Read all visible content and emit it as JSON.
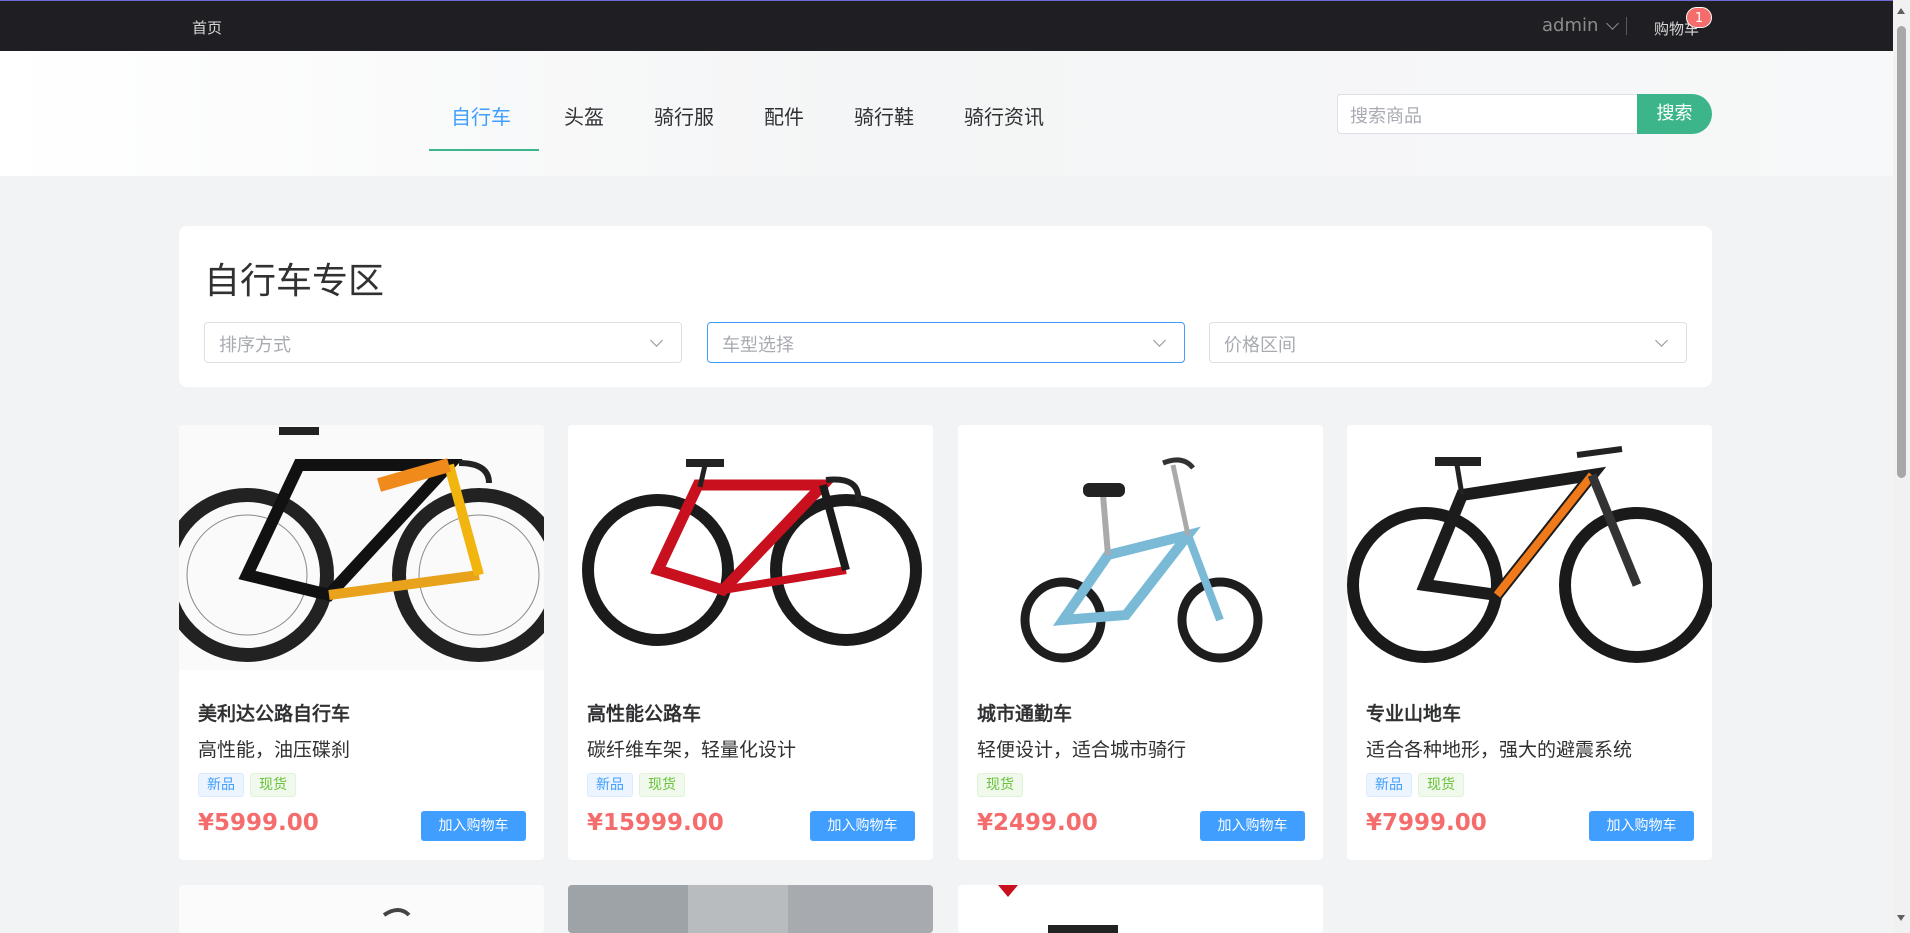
{
  "topbar": {
    "home": "首页",
    "user": "admin",
    "cart": "购物车",
    "cart_count": "1"
  },
  "nav": {
    "tabs": [
      "自行车",
      "头盔",
      "骑行服",
      "配件",
      "骑行鞋",
      "骑行资讯"
    ],
    "active_tab": "自行车",
    "search_placeholder": "搜索商品",
    "search_button": "搜索"
  },
  "section": {
    "title": "自行车专区",
    "filters": [
      "排序方式",
      "车型选择",
      "价格区间"
    ]
  },
  "products": [
    {
      "name": "美利达公路自行车",
      "desc": "高性能，油压碟刹",
      "tags": [
        "新品",
        "现货"
      ],
      "price": "¥5999.00",
      "button": "加入购物车"
    },
    {
      "name": "高性能公路车",
      "desc": "碳纤维车架，轻量化设计",
      "tags": [
        "新品",
        "现货"
      ],
      "price": "¥15999.00",
      "button": "加入购物车"
    },
    {
      "name": "城市通勤车",
      "desc": "轻便设计，适合城市骑行",
      "tags": [
        "现货"
      ],
      "price": "¥2499.00",
      "button": "加入购物车"
    },
    {
      "name": "专业山地车",
      "desc": "适合各种地形，强大的避震系统",
      "tags": [
        "新品",
        "现货"
      ],
      "price": "¥7999.00",
      "button": "加入购物车"
    }
  ],
  "colors": {
    "accent": "#409eff",
    "brand_green": "#3db58a",
    "price_red": "#f56c6c",
    "topbar": "#1f1f23"
  }
}
